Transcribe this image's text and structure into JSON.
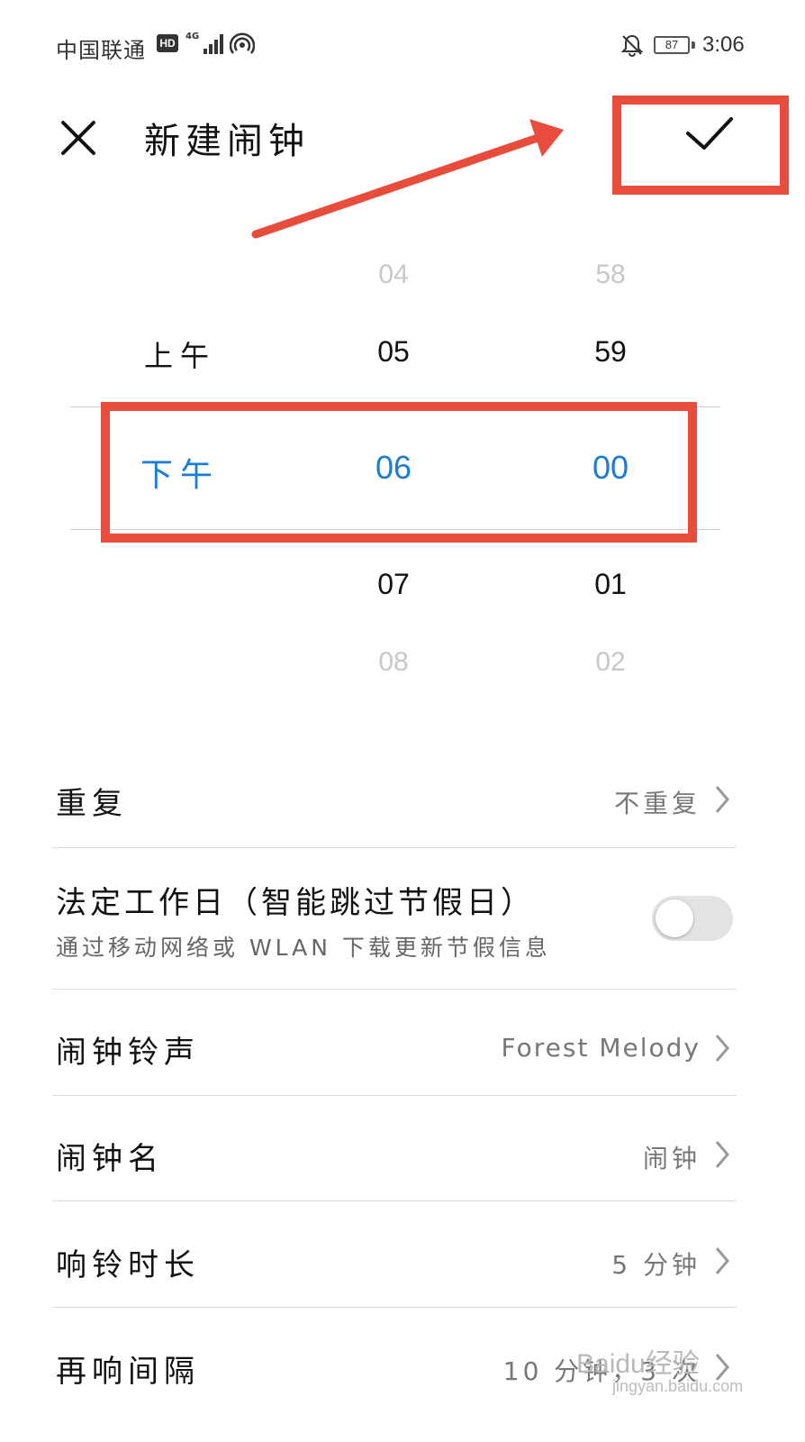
{
  "status_bar": {
    "carrier": "中国联通",
    "hd_badge": "HD",
    "network_type": "4G",
    "battery_level": "87",
    "time": "3:06",
    "icons": [
      "signal-icon",
      "hotspot-icon",
      "bell-off-icon",
      "battery-icon"
    ]
  },
  "header": {
    "title": "新建闹钟",
    "close_icon": "close-icon",
    "confirm_icon": "check-icon"
  },
  "time_picker": {
    "ampm": {
      "above": "上午",
      "selected": "下午"
    },
    "hour": {
      "above2": "04",
      "above1": "05",
      "selected": "06",
      "below1": "07",
      "below2": "08"
    },
    "minute": {
      "above2": "58",
      "above1": "59",
      "selected": "00",
      "below1": "01",
      "below2": "02"
    }
  },
  "settings": {
    "repeat": {
      "label": "重复",
      "value": "不重复"
    },
    "workday": {
      "label": "法定工作日（智能跳过节假日）",
      "description": "通过移动网络或 WLAN 下载更新节假信息",
      "enabled": false
    },
    "ringtone": {
      "label": "闹钟铃声",
      "value": "Forest Melody"
    },
    "name": {
      "label": "闹钟名",
      "value": "闹钟"
    },
    "duration": {
      "label": "响铃时长",
      "value": "5 分钟"
    },
    "snooze": {
      "label": "再响间隔",
      "value": "10 分钟，3 次"
    }
  },
  "watermark": {
    "main": "Baidu经验",
    "sub": "jingyan.baidu.com"
  },
  "colors": {
    "accent": "#1a7cd3",
    "annotation_red": "#e84c3d"
  }
}
